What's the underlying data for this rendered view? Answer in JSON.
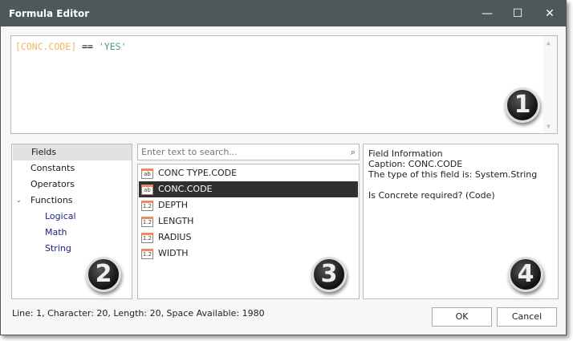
{
  "window": {
    "title": "Formula Editor",
    "minimize_icon": "—",
    "maximize_icon": "☐",
    "close_icon": "✕"
  },
  "editor": {
    "field": "[CONC.CODE]",
    "operator": "==",
    "string": "'YES'",
    "colors": {
      "field": "#f0b660",
      "operator": "#000000",
      "string": "#4a9a8a"
    }
  },
  "tree": {
    "items": [
      {
        "label": "Fields"
      },
      {
        "label": "Constants"
      },
      {
        "label": "Operators"
      },
      {
        "label": "Functions"
      },
      {
        "label": "Logical"
      },
      {
        "label": "Math"
      },
      {
        "label": "String"
      }
    ]
  },
  "search": {
    "placeholder": "Enter text to search..."
  },
  "fields": [
    {
      "icon": "ab",
      "label": "CONC TYPE.CODE"
    },
    {
      "icon": "ab",
      "label": "CONC.CODE"
    },
    {
      "icon": "1.2",
      "label": "DEPTH"
    },
    {
      "icon": "1.2",
      "label": "LENGTH"
    },
    {
      "icon": "1.2",
      "label": "RADIUS"
    },
    {
      "icon": "1.2",
      "label": "WIDTH"
    }
  ],
  "info": {
    "heading": "Field Information",
    "caption": "Caption: CONC.CODE",
    "type": "The type of this field is: System.String",
    "description": "Is Concrete required? (Code)"
  },
  "badges": [
    "1",
    "2",
    "3",
    "4"
  ],
  "status": "Line: 1, Character: 20, Length: 20, Space Available: 1980",
  "buttons": {
    "ok": "OK",
    "cancel": "Cancel"
  }
}
